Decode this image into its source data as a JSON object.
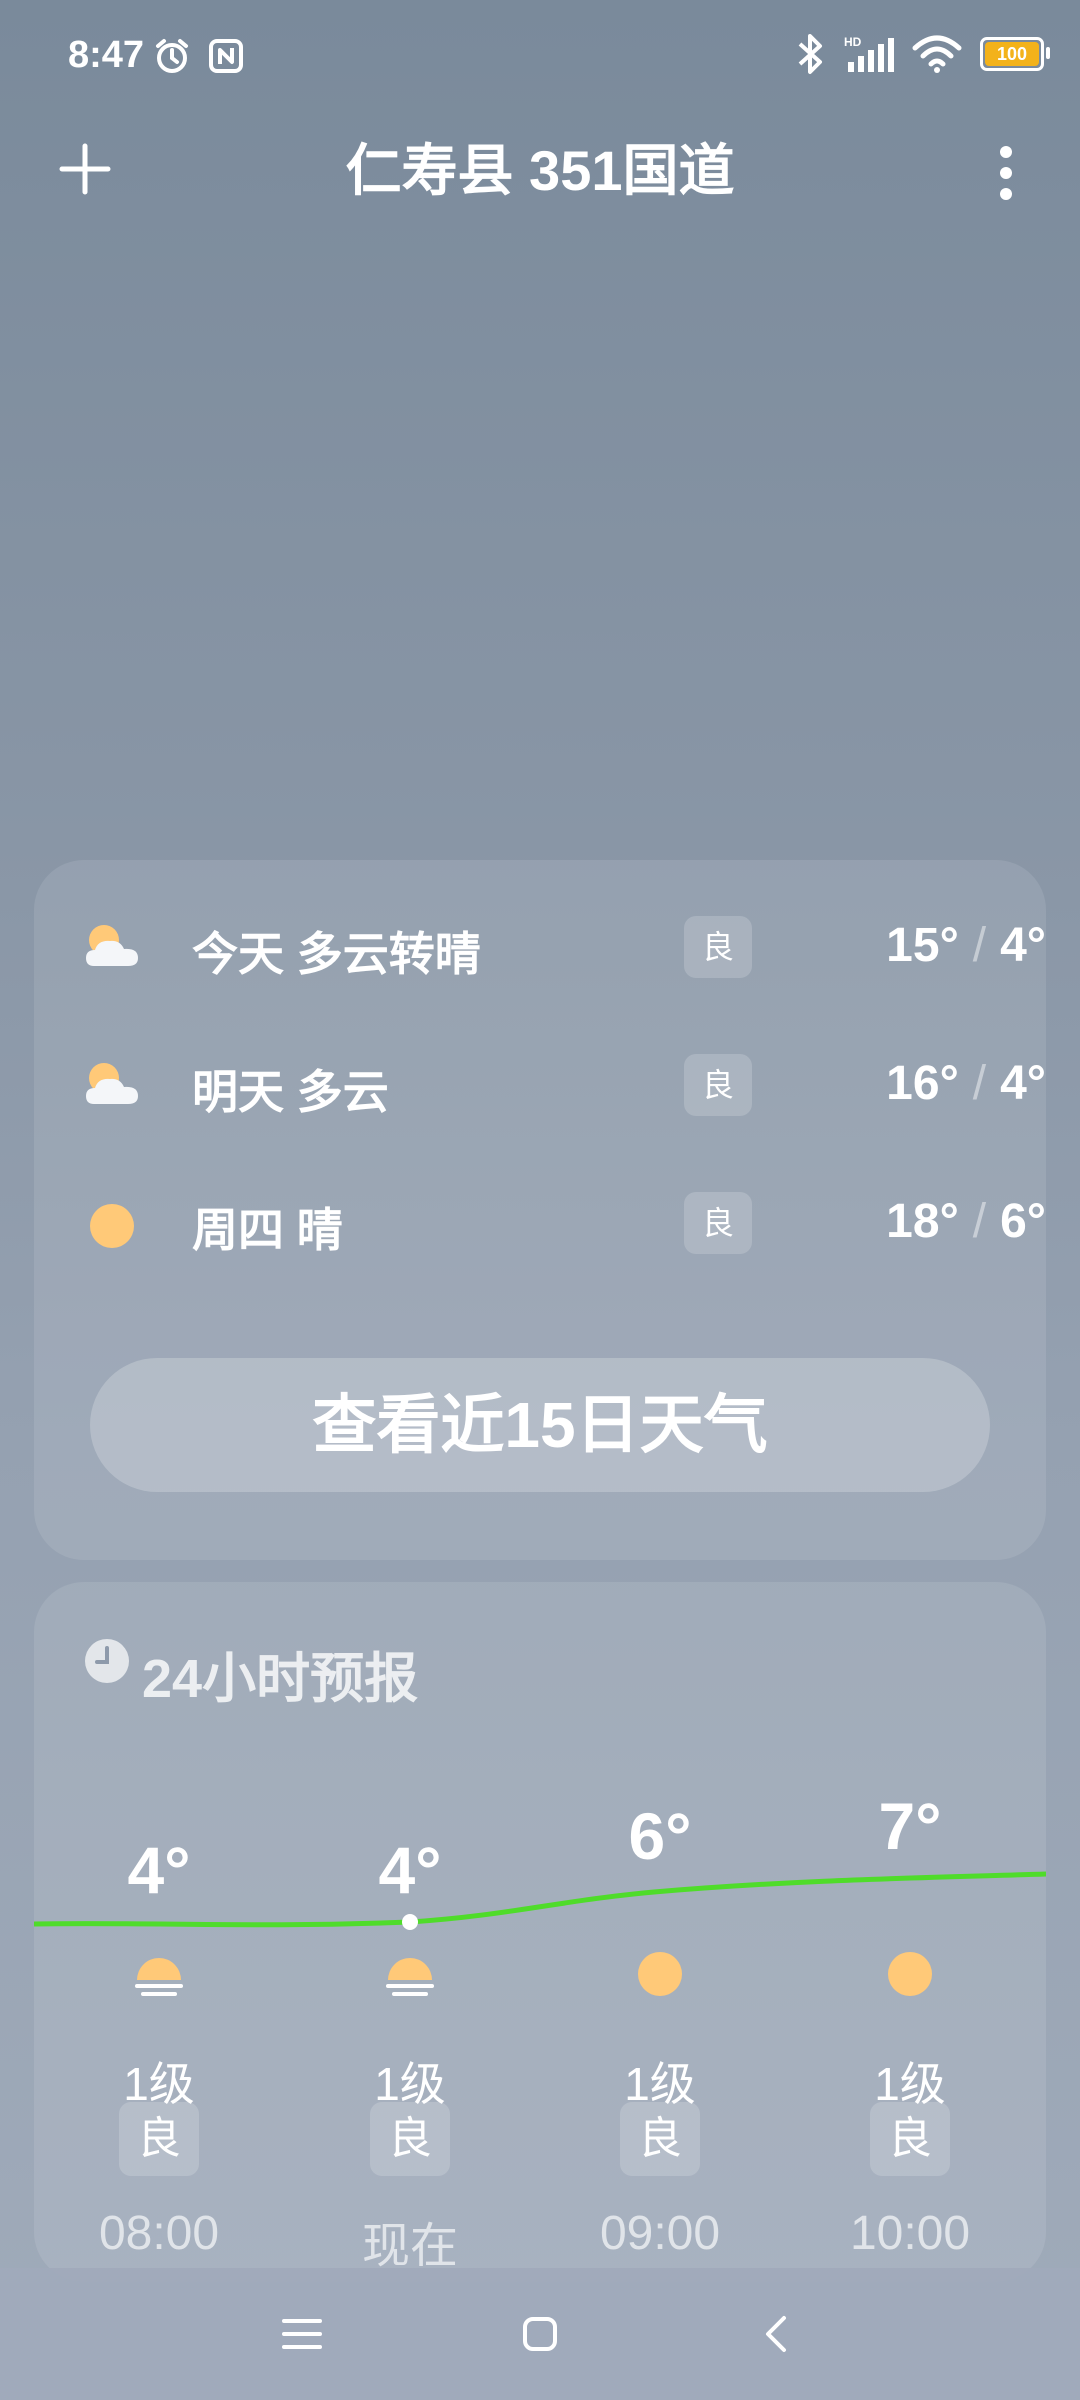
{
  "status_bar": {
    "time": "8:47",
    "battery": "100",
    "icons": [
      "alarm-icon",
      "nfc-icon",
      "bluetooth-icon",
      "hd-signal-icon",
      "wifi-icon",
      "battery-icon"
    ]
  },
  "header": {
    "title": "仁寿县 351国道",
    "add_icon": "plus-icon",
    "more_icon": "more-vertical-icon"
  },
  "forecast": {
    "days": [
      {
        "label": "今天  多云转晴",
        "aqi": "良",
        "high": "15°",
        "low": "4°",
        "icon": "partly-cloudy-icon"
      },
      {
        "label": "明天  多云",
        "aqi": "良",
        "high": "16°",
        "low": "4°",
        "icon": "partly-cloudy-icon"
      },
      {
        "label": "周四  晴",
        "aqi": "良",
        "high": "18°",
        "low": "6°",
        "icon": "sun-icon"
      }
    ],
    "button_label": "查看近15日天气"
  },
  "hourly": {
    "title": "24小时预报",
    "hours": [
      {
        "temp": "4°",
        "wind": "1级",
        "aqi": "良",
        "time": "08:00",
        "icon": "sunrise-icon"
      },
      {
        "temp": "4°",
        "wind": "1级",
        "aqi": "良",
        "time": "现在",
        "icon": "sunrise-icon"
      },
      {
        "temp": "6°",
        "wind": "1级",
        "aqi": "良",
        "time": "09:00",
        "icon": "sun-icon"
      },
      {
        "temp": "7°",
        "wind": "1级",
        "aqi": "良",
        "time": "10:00",
        "icon": "sun-icon"
      }
    ]
  },
  "colors": {
    "temp_curve": "#4fdc2a",
    "sun": "#ffc978",
    "battery_fill": "#f3b21a"
  }
}
